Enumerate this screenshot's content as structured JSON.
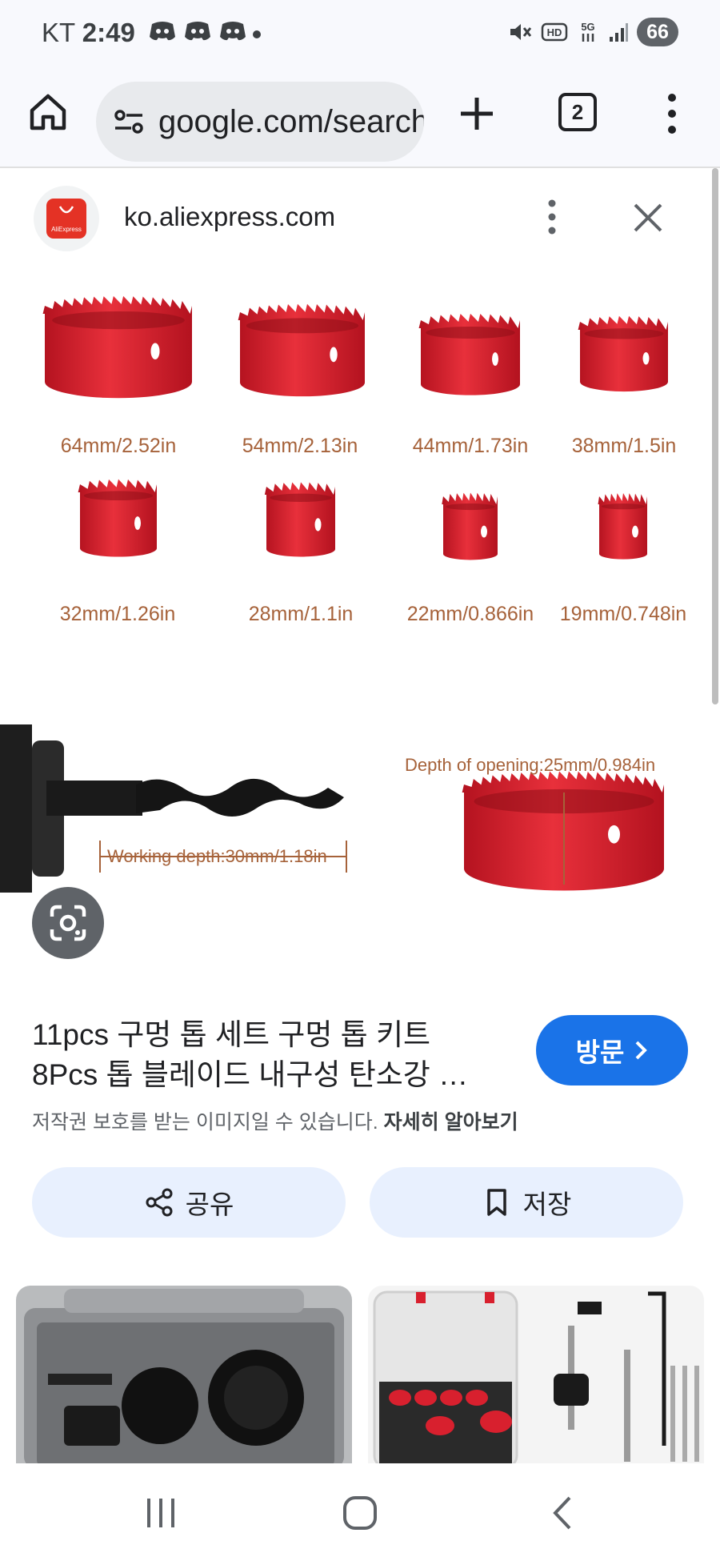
{
  "status_bar": {
    "carrier": "KT",
    "time": "2:49",
    "battery": "66"
  },
  "browser": {
    "url": "google.com/search",
    "tab_count": "2"
  },
  "source": {
    "domain": "ko.aliexpress.com",
    "logo_text": "AliExpress"
  },
  "product_image": {
    "sizes_row1": [
      "64mm/2.52in",
      "54mm/2.13in",
      "44mm/1.73in",
      "38mm/1.5in"
    ],
    "sizes_row2": [
      "32mm/1.26in",
      "28mm/1.1in",
      "22mm/0.866in",
      "19mm/0.748in"
    ],
    "working_depth": "Working depth:30mm/1.18in",
    "opening_depth": "Depth of opening:25mm/0.984in"
  },
  "result": {
    "title_line1": "11pcs 구멍 톱 세트 구멍 톱 키트",
    "title_line2": "8Pcs 톱 블레이드 내구성 탄소강 …",
    "visit_label": "방문",
    "copyright_text": "저작권 보호를 받는 이미지일 수 있습니다.",
    "learn_more": "자세히 알아보기"
  },
  "actions": {
    "share_label": "공유",
    "save_label": "저장"
  },
  "colors": {
    "accent": "#1a73e8",
    "saw_red": "#d8202e",
    "pill_bg": "#e8f0fe"
  }
}
